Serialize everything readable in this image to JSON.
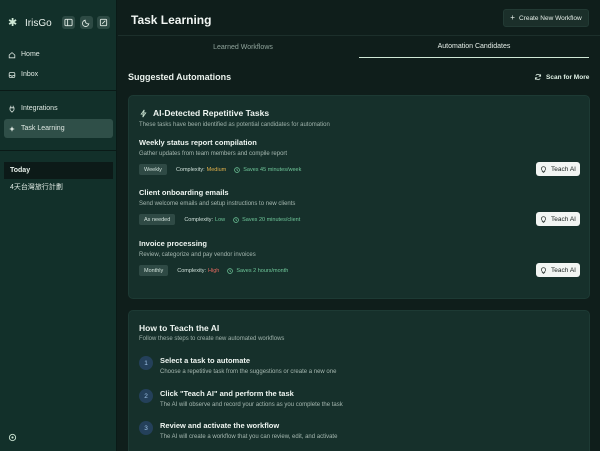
{
  "app": {
    "name": "IrisGo"
  },
  "sidebar": {
    "nav": [
      {
        "label": "Home"
      },
      {
        "label": "Inbox"
      },
      {
        "label": "Integrations"
      },
      {
        "label": "Task Learning"
      }
    ],
    "history_heading": "Today",
    "history_items": [
      "4天台灣旅行計劃"
    ]
  },
  "header": {
    "title": "Task Learning",
    "create_button": "Create New Workflow"
  },
  "tabs": [
    {
      "label": "Learned Workflows"
    },
    {
      "label": "Automation Candidates"
    }
  ],
  "suggested": {
    "title": "Suggested Automations",
    "scan_button": "Scan for More",
    "card_title": "AI-Detected Repetitive Tasks",
    "card_subtitle": "These tasks have been identified as potential candidates for automation",
    "tasks": [
      {
        "name": "Weekly status report compilation",
        "description": "Gather updates from team members and compile report",
        "frequency": "Weekly",
        "complexity_label": "Complexity:",
        "complexity": "Medium",
        "savings": "Saves 45 minutes/week",
        "button": "Teach AI"
      },
      {
        "name": "Client onboarding emails",
        "description": "Send welcome emails and setup instructions to new clients",
        "frequency": "As needed",
        "complexity_label": "Complexity:",
        "complexity": "Low",
        "savings": "Saves 20 minutes/client",
        "button": "Teach AI"
      },
      {
        "name": "Invoice processing",
        "description": "Review, categorize and pay vendor invoices",
        "frequency": "Monthly",
        "complexity_label": "Complexity:",
        "complexity": "High",
        "savings": "Saves 2 hours/month",
        "button": "Teach AI"
      }
    ]
  },
  "howto": {
    "title": "How to Teach the AI",
    "subtitle": "Follow these steps to create new automated workflows",
    "steps": [
      {
        "num": "1",
        "title": "Select a task to automate",
        "description": "Choose a repetitive task from the suggestions or create a new one"
      },
      {
        "num": "2",
        "title": "Click \"Teach AI\" and perform the task",
        "description": "The AI will observe and record your actions as you complete the task"
      },
      {
        "num": "3",
        "title": "Review and activate the workflow",
        "description": "The AI will create a workflow that you can review, edit, and activate"
      }
    ]
  },
  "colors": {
    "medium": "#e0b04a",
    "low": "#6fc79a",
    "high": "#e2685f",
    "accent": "#cfe8d6"
  },
  "icons": [
    "sparkle-icon",
    "panel-icon",
    "moon-icon",
    "edit-icon",
    "home-icon",
    "inbox-icon",
    "plug-icon",
    "learning-icon",
    "settings-icon",
    "plus-icon",
    "scan-icon",
    "lightning-icon",
    "clock-icon",
    "lightbulb-icon"
  ]
}
